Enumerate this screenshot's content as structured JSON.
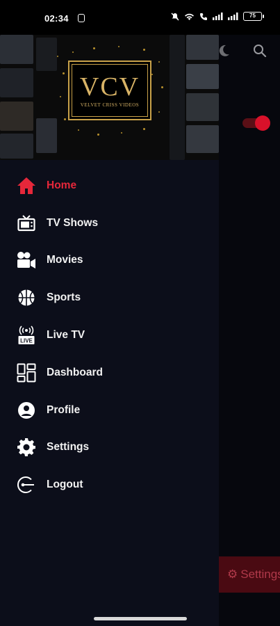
{
  "status_bar": {
    "time": "02:34",
    "battery": "75"
  },
  "drawer": {
    "logo": {
      "text": "VCV",
      "subtitle": "VELVET CRISS VIDEOS"
    },
    "menu_items": [
      {
        "label": "Home",
        "icon": "home-icon",
        "active": true
      },
      {
        "label": "TV Shows",
        "icon": "tv-icon",
        "active": false
      },
      {
        "label": "Movies",
        "icon": "movie-camera-icon",
        "active": false
      },
      {
        "label": "Sports",
        "icon": "basketball-icon",
        "active": false
      },
      {
        "label": "Live TV",
        "icon": "live-tv-icon",
        "active": false
      },
      {
        "label": "Dashboard",
        "icon": "dashboard-icon",
        "active": false
      },
      {
        "label": "Profile",
        "icon": "profile-icon",
        "active": false
      },
      {
        "label": "Settings",
        "icon": "gear-icon",
        "active": false
      },
      {
        "label": "Logout",
        "icon": "logout-icon",
        "active": false
      }
    ]
  },
  "background": {
    "settings_button": "Settings"
  },
  "colors": {
    "accent": "#e6273a",
    "drawer_bg": "#0c0e1a",
    "logo_gold": "#d8b366"
  }
}
